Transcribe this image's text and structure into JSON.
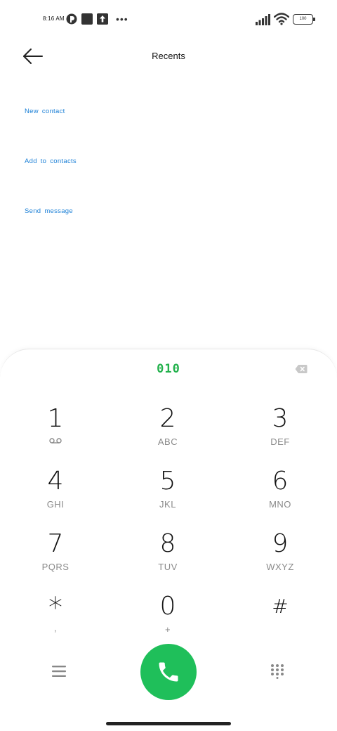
{
  "status_bar": {
    "time": "8:16 AM",
    "battery_level": "100",
    "icons": [
      "notification-circle-icon",
      "notification-square-icon",
      "upload-icon",
      "more-dots-icon",
      "signal-icon",
      "wifi-icon",
      "battery-icon"
    ]
  },
  "header": {
    "title": "Recents",
    "back_icon": "arrow-left-icon"
  },
  "actions": [
    {
      "label": "New  contact"
    },
    {
      "label": "Add  to  contacts"
    },
    {
      "label": "Send  message"
    }
  ],
  "dialer": {
    "number": "010",
    "keys": [
      {
        "digit": "1",
        "letters": ""
      },
      {
        "digit": "2",
        "letters": "ABC"
      },
      {
        "digit": "3",
        "letters": "DEF"
      },
      {
        "digit": "4",
        "letters": "GHI"
      },
      {
        "digit": "5",
        "letters": "JKL"
      },
      {
        "digit": "6",
        "letters": "MNO"
      },
      {
        "digit": "7",
        "letters": "PQRS"
      },
      {
        "digit": "8",
        "letters": "TUV"
      },
      {
        "digit": "9",
        "letters": "WXYZ"
      },
      {
        "digit": "*",
        "letters": ","
      },
      {
        "digit": "0",
        "letters": "+"
      },
      {
        "digit": "#",
        "letters": ""
      }
    ]
  },
  "colors": {
    "accent_link": "#1a7fd6",
    "dialed_number": "#22b14c",
    "call_button": "#1fbf5a"
  }
}
